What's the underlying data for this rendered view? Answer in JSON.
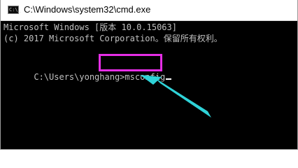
{
  "window": {
    "title": "C:\\Windows\\system32\\cmd.exe",
    "icon": "cmd-icon",
    "icon_glyph": "C:\\_"
  },
  "console": {
    "line1": "Microsoft Windows [版本 10.0.15063]",
    "line2": "(c) 2017 Microsoft Corporation。保留所有权利。",
    "prompt": "C:\\Users\\yonghang>",
    "command": "msconfig"
  },
  "colors": {
    "console_bg": "#000000",
    "console_text": "#c0c0c0",
    "highlight": "#e62ee6",
    "arrow": "#2fd3d8"
  }
}
